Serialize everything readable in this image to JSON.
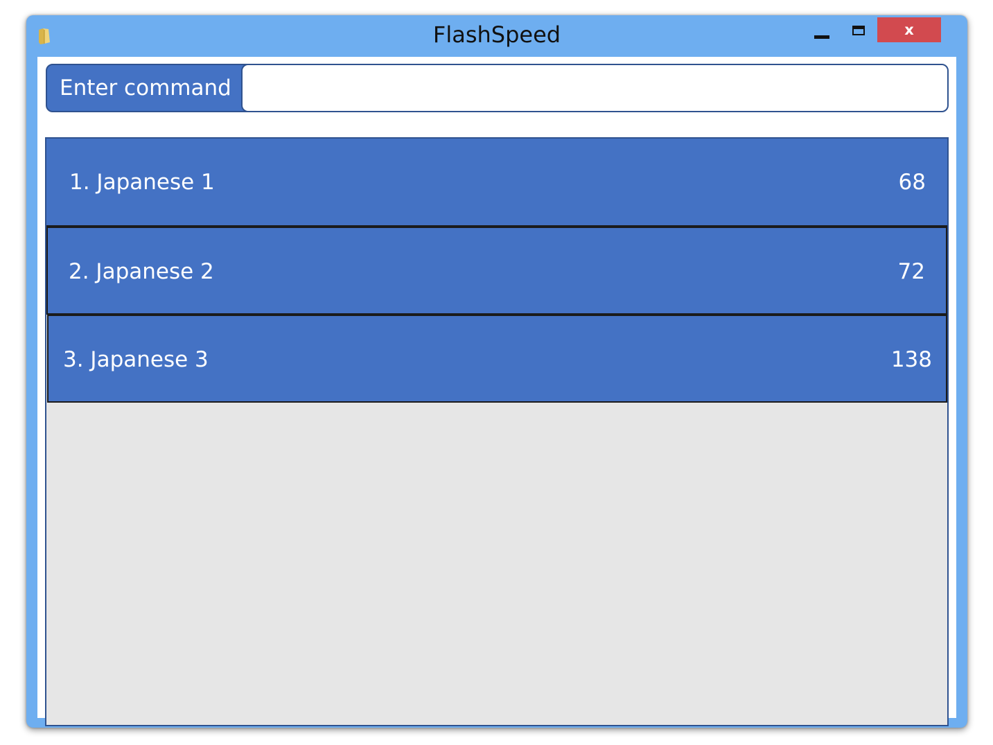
{
  "window": {
    "title": "FlashSpeed",
    "app_icon": "folder-icon",
    "controls": {
      "minimize_icon": "minimize-icon",
      "maximize_icon": "maximize-icon",
      "close_label": "x"
    }
  },
  "command": {
    "label": "Enter command",
    "value": "",
    "placeholder": ""
  },
  "decks": [
    {
      "label": "1. Japanese 1",
      "count": "68"
    },
    {
      "label": "2. Japanese 2",
      "count": "72"
    },
    {
      "label": "3. Japanese 3",
      "count": "138"
    }
  ],
  "colors": {
    "window_frame": "#6eaef0",
    "accent": "#4472c4",
    "accent_border": "#2f528f",
    "close_button": "#d24a4f",
    "list_background": "#e6e6e6"
  }
}
